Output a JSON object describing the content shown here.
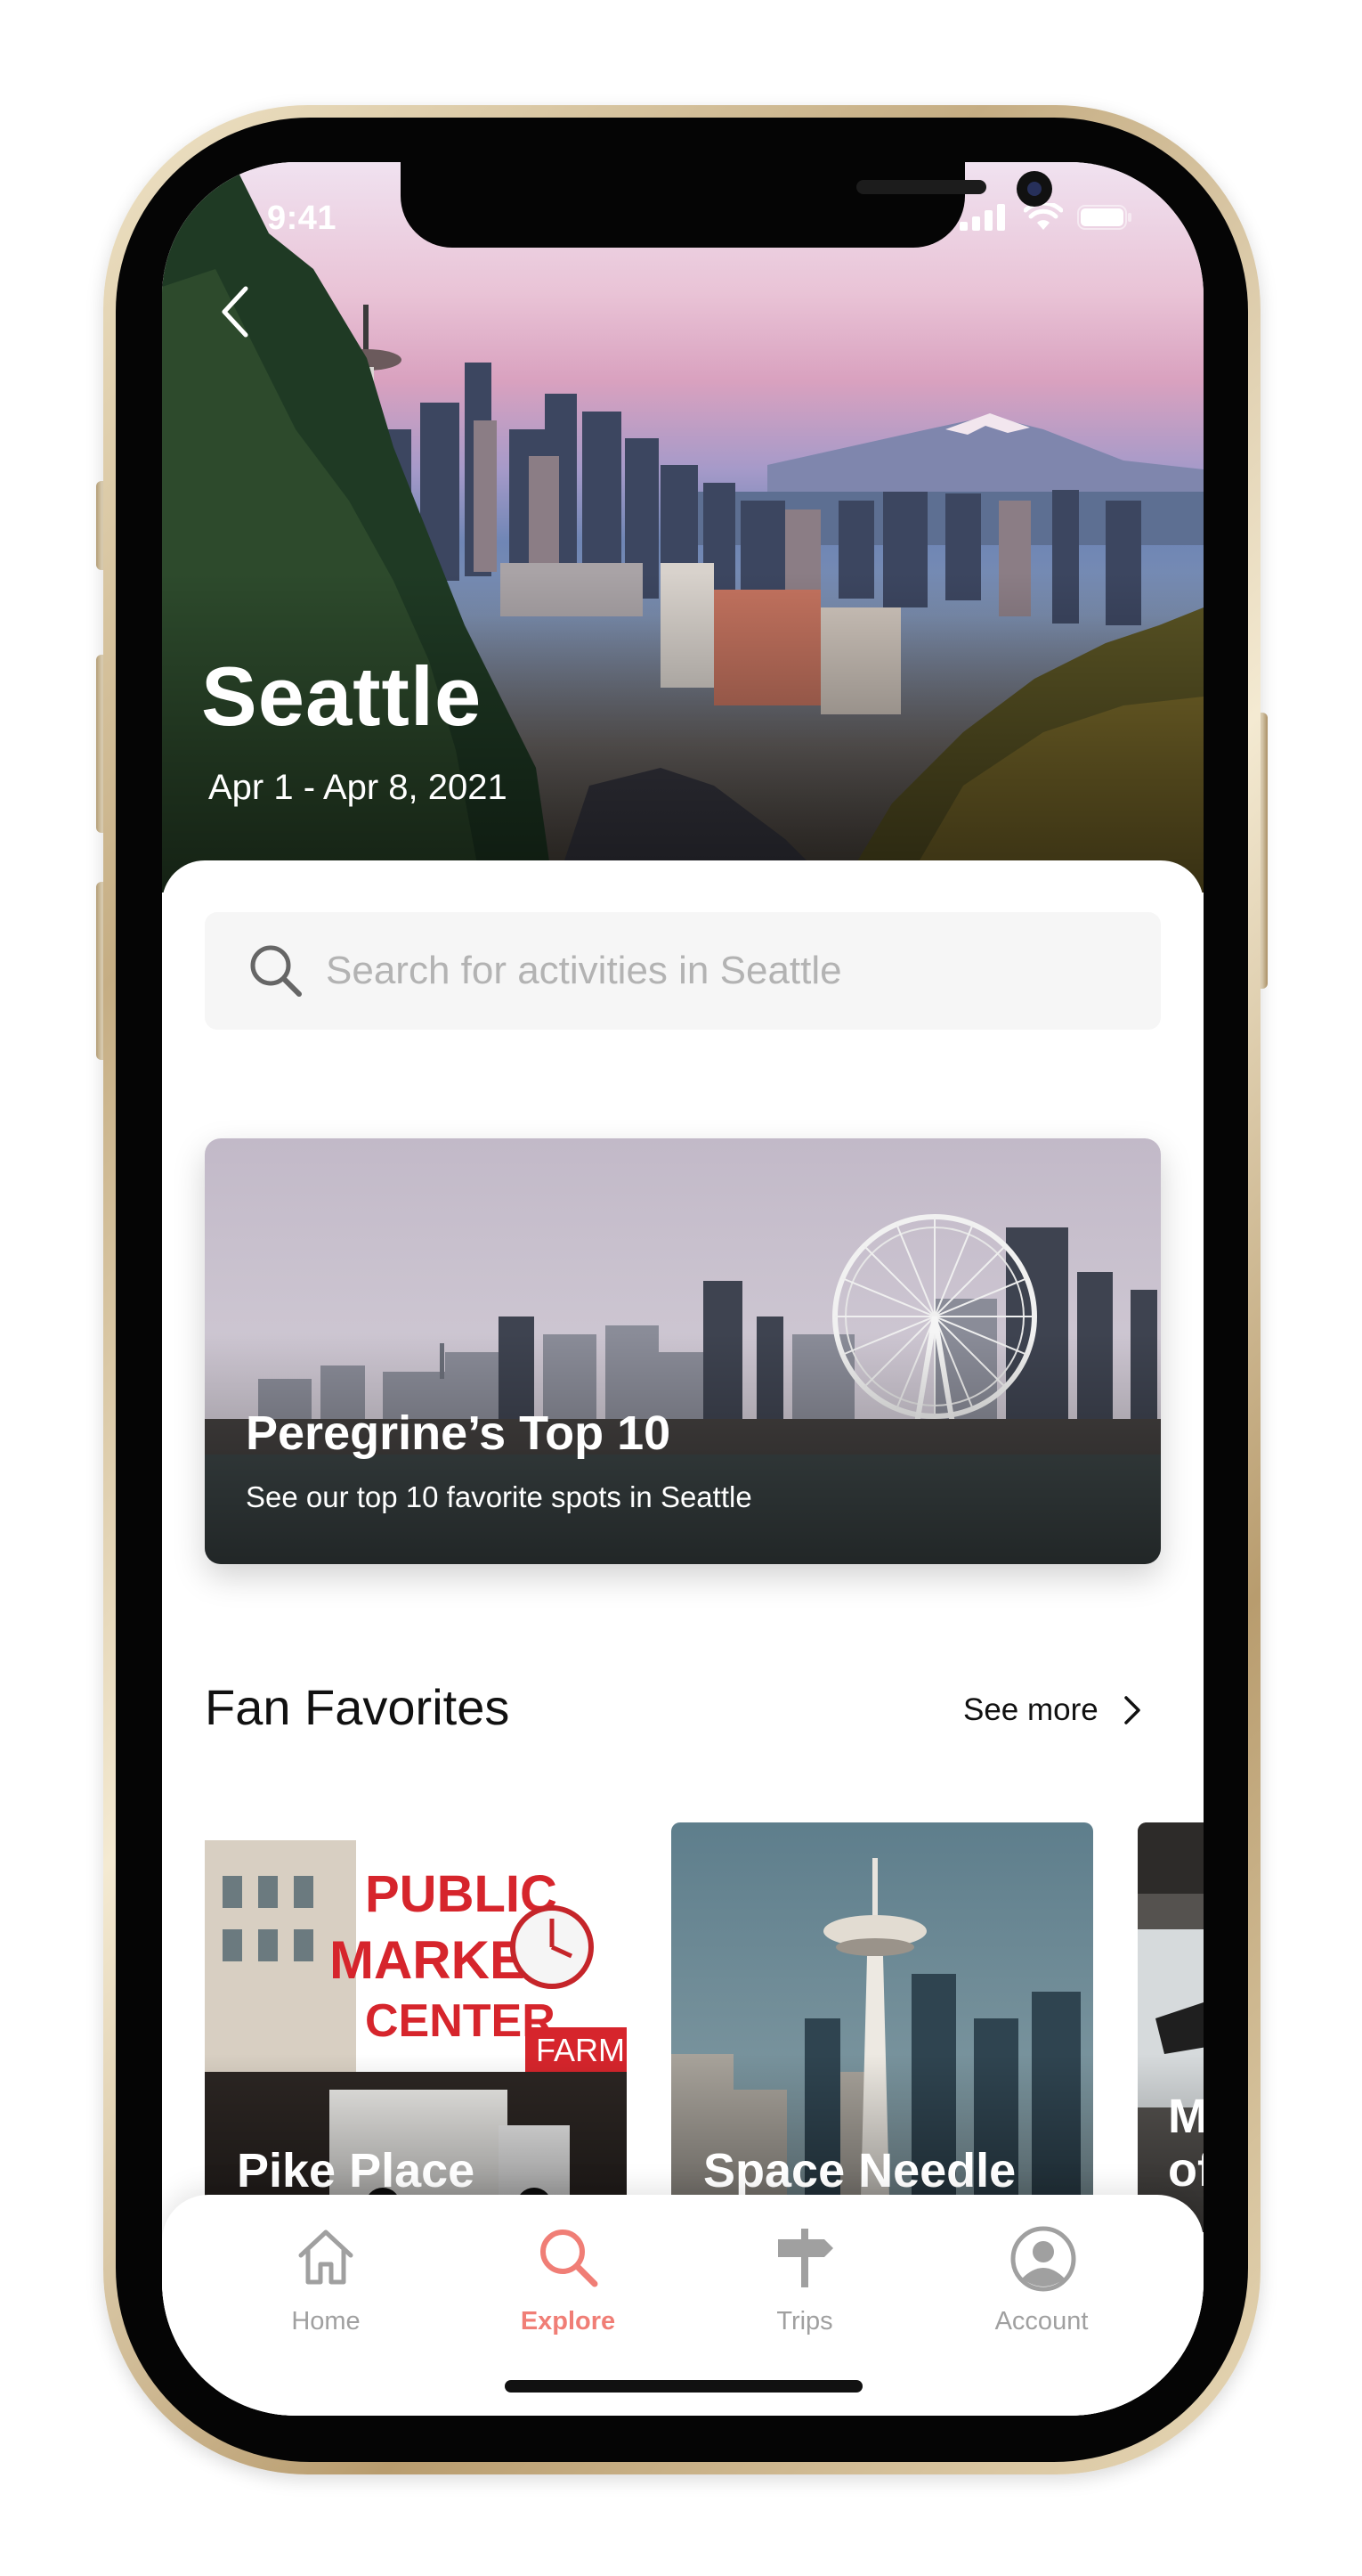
{
  "status_bar": {
    "time": "9:41"
  },
  "hero": {
    "title": "Seattle",
    "dates": "Apr 1 - Apr 8, 2021"
  },
  "search": {
    "placeholder": "Search for activities in Seattle"
  },
  "featured": {
    "title": "Peregrine’s Top 10",
    "subtitle": "See our top 10 favorite spots in Seattle"
  },
  "fan_favorites": {
    "title": "Fan Favorites",
    "see_more": "See more",
    "cards": [
      {
        "label": "Pike Place"
      },
      {
        "label": "Space Needle"
      },
      {
        "label": "M of"
      }
    ]
  },
  "tabs": [
    {
      "label": "Home",
      "icon": "home-icon",
      "active": false
    },
    {
      "label": "Explore",
      "icon": "search-icon",
      "active": true
    },
    {
      "label": "Trips",
      "icon": "signpost-icon",
      "active": false
    },
    {
      "label": "Account",
      "icon": "person-circle-icon",
      "active": false
    }
  ],
  "colors": {
    "accent": "#f07e76",
    "inactive_tab": "#a0a0a0",
    "search_bg": "#f6f6f6",
    "frame_gold": "#c5ad83"
  }
}
